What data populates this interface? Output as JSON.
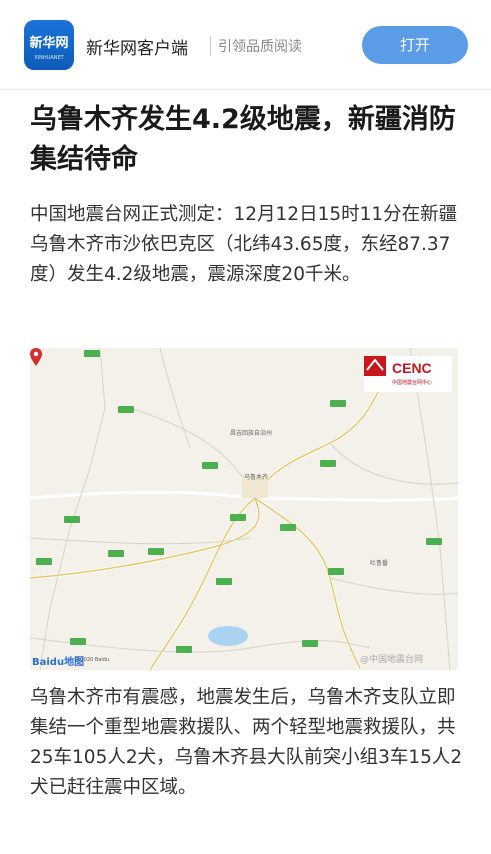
{
  "appbar": {
    "logo_main": "新华网",
    "logo_sub": "XINHUANET",
    "app_name": "新华网客户端",
    "slogan": "引领品质阅读",
    "open_button": "打开"
  },
  "article": {
    "title": "乌鲁木齐发生4.2级地震，新疆消防集结待命",
    "paragraph_1": "中国地震台网正式测定：12月12日15时11分在新疆乌鲁木齐市沙依巴克区（北纬43.65度，东经87.37度）发生4.2级地震，震源深度20千米。",
    "paragraph_2": "乌鲁木齐市有震感，地震发生后，乌鲁木齐支队立即集结一个重型地震救援队、两个轻型地震救援队，共25车105人2犬，乌鲁木齐县大队前突小组3车15人2犬已赶往震中区域。"
  },
  "map": {
    "cenc_logo": "CENC",
    "cenc_sub": "中国地震台网中心",
    "city_label": "乌鲁木齐",
    "region_label": "昌吉回族自治州",
    "town_label": "吐鲁番",
    "baidu_logo": "Baidu地图",
    "copyright": "© 2020 Baidu",
    "watermark": "@中国地震台网"
  },
  "colors": {
    "brand_blue": "#1a73d9",
    "button_blue": "#5b9ce6",
    "road_green": "#4caf50",
    "pin_red": "#d32f2f",
    "cenc_red": "#c8161d"
  }
}
